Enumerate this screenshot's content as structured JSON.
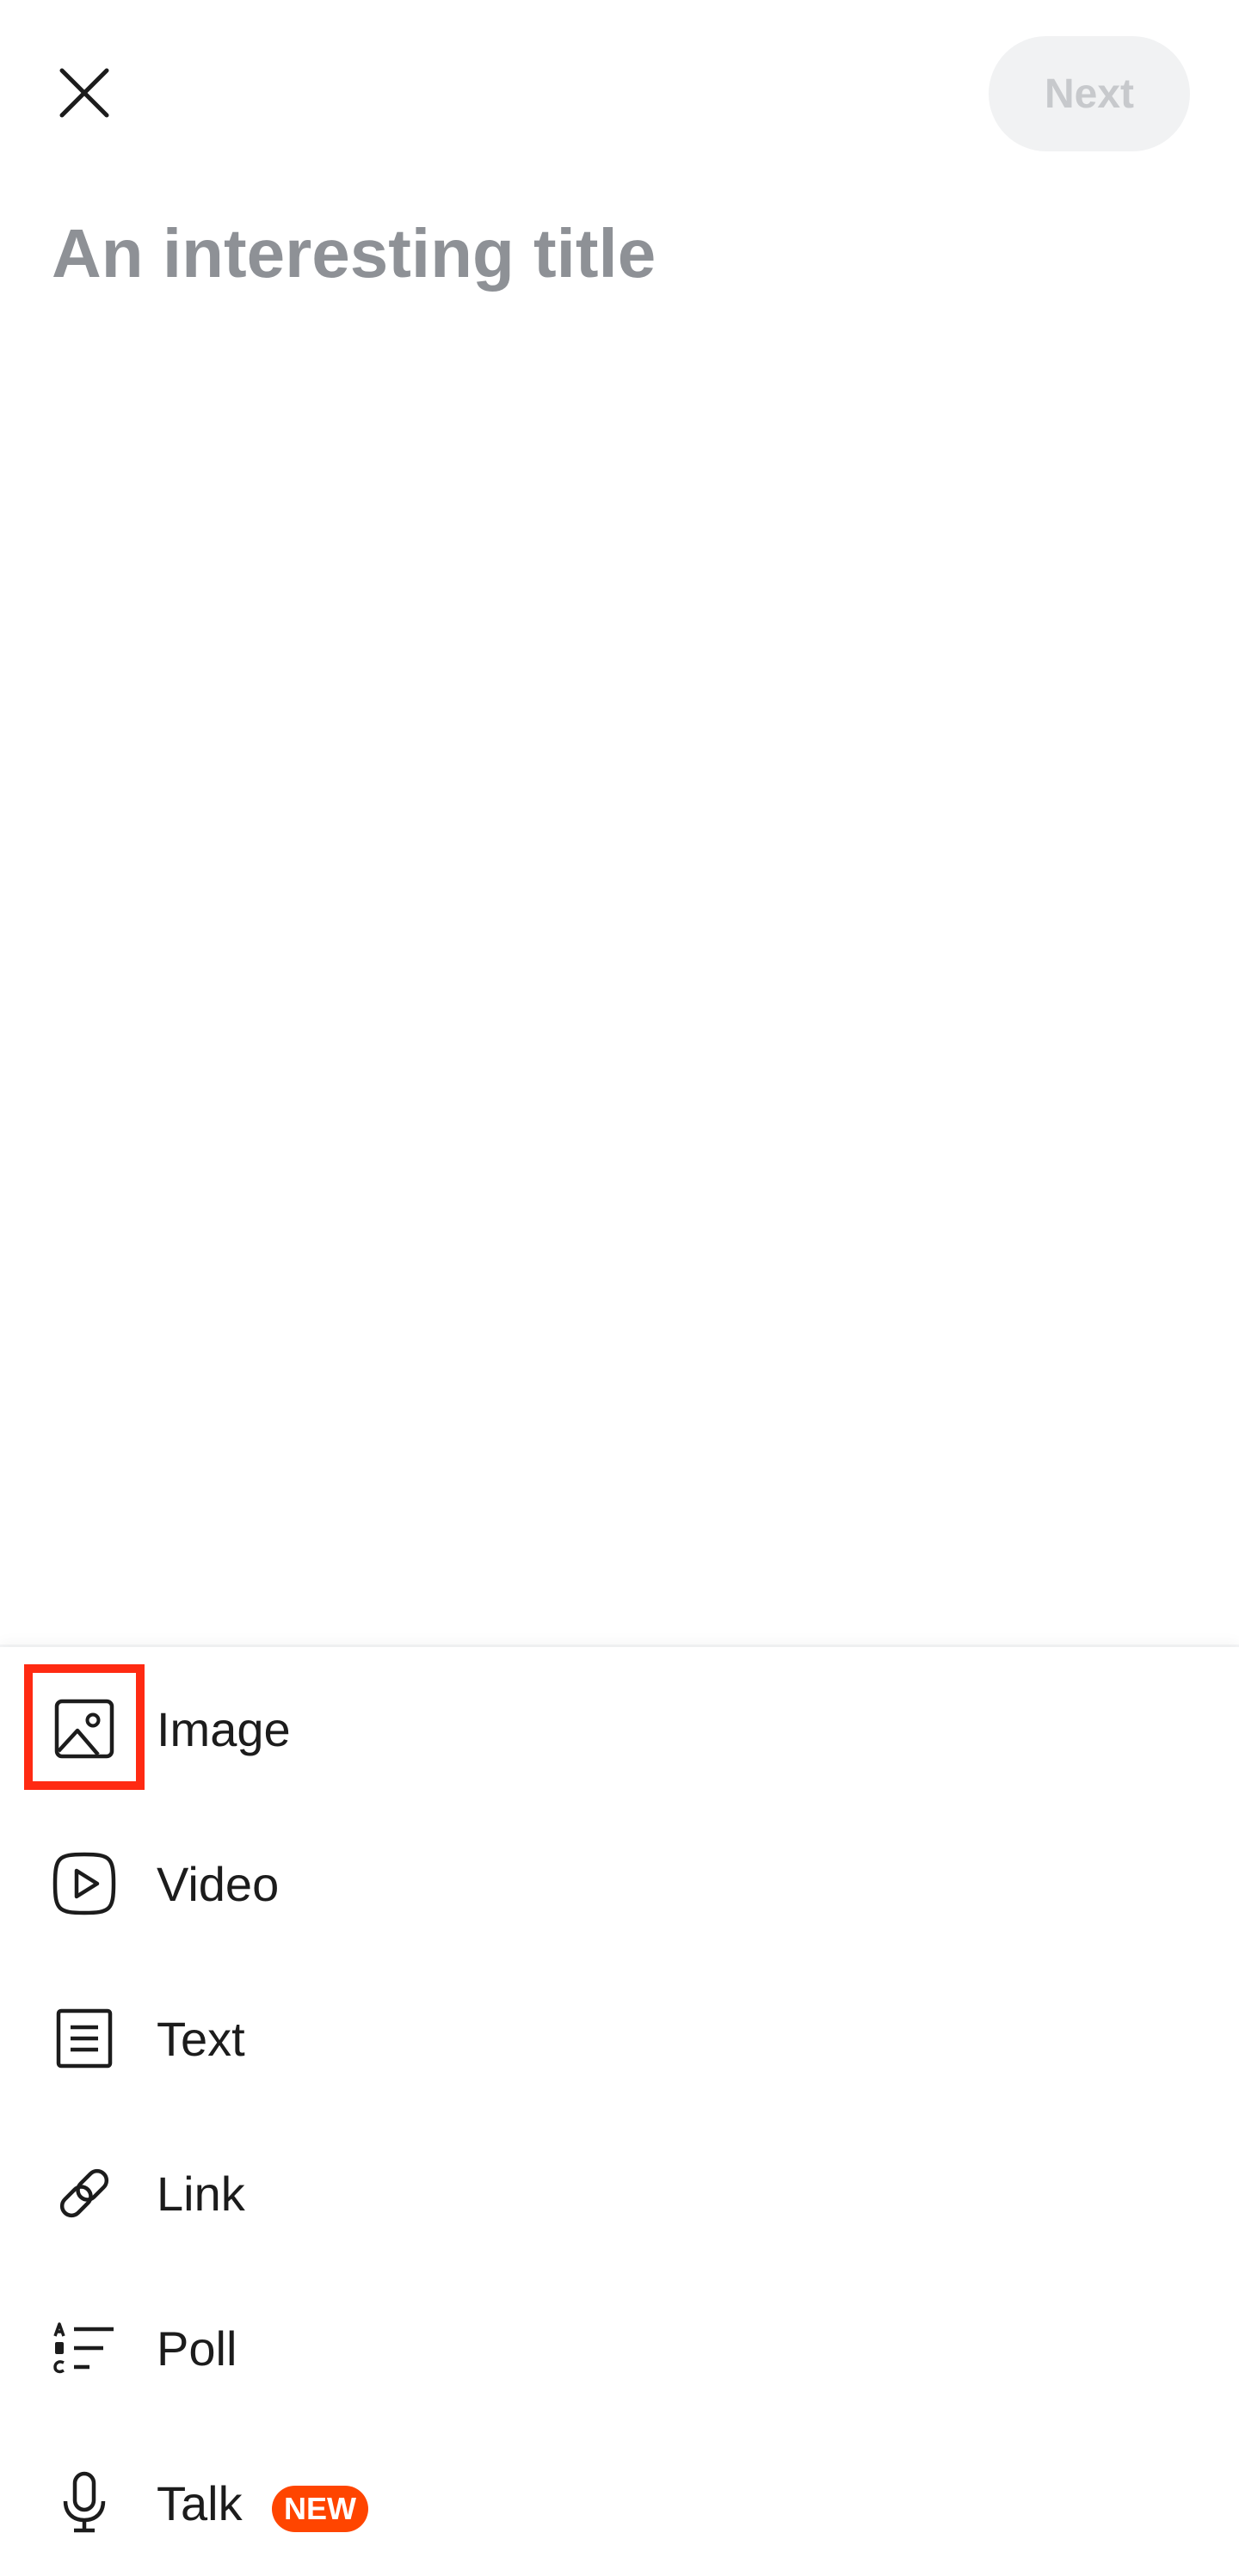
{
  "header": {
    "next_label": "Next"
  },
  "title_field": {
    "placeholder": "An interesting title",
    "value": ""
  },
  "options": [
    {
      "label": "Image",
      "icon": "image-icon"
    },
    {
      "label": "Video",
      "icon": "video-icon"
    },
    {
      "label": "Text",
      "icon": "text-icon"
    },
    {
      "label": "Link",
      "icon": "link-icon"
    },
    {
      "label": "Poll",
      "icon": "poll-icon"
    },
    {
      "label": "Talk",
      "icon": "microphone-icon",
      "badge": "NEW"
    }
  ],
  "colors": {
    "badge": "#ff4500",
    "highlight": "#ff2a12",
    "next_disabled_bg": "#f1f2f3",
    "next_disabled_text": "#c7c9cc"
  }
}
